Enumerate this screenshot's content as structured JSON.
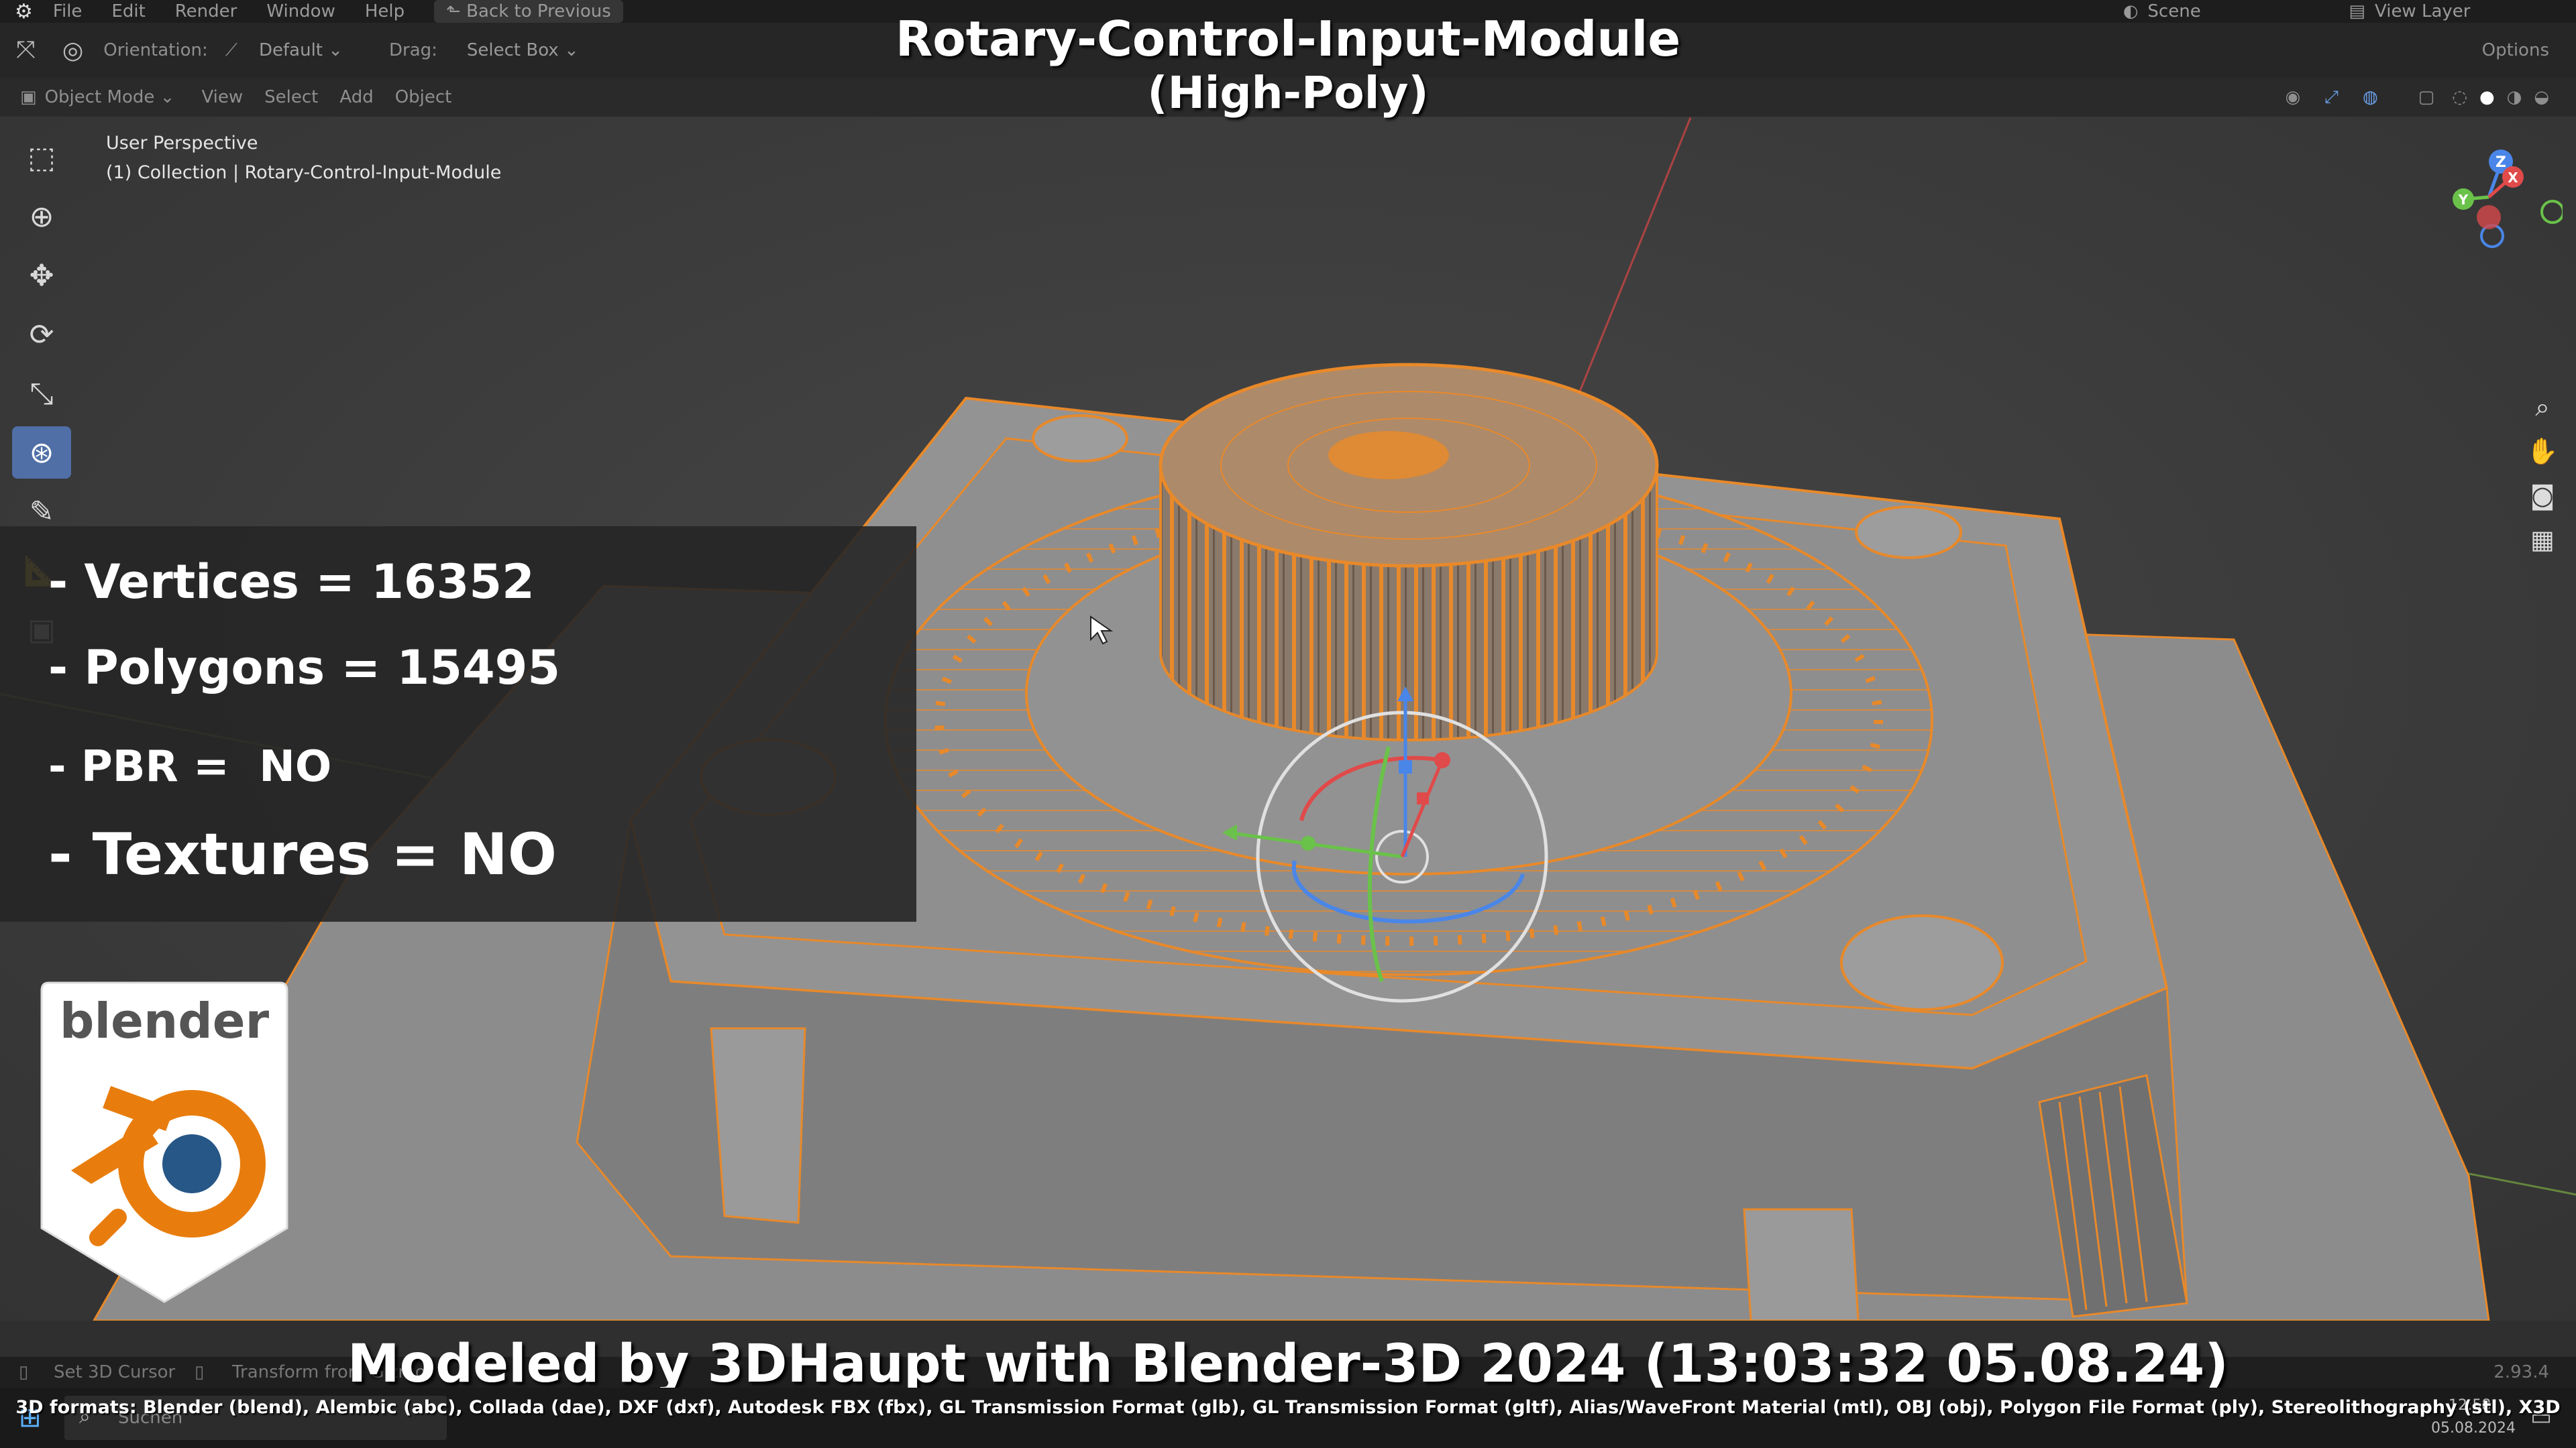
{
  "menubar": {
    "items": [
      "File",
      "Edit",
      "Render",
      "Window",
      "Help"
    ],
    "back_label": "Back to Previous",
    "scene_label": "Scene",
    "view_layer_label": "View Layer"
  },
  "toolbar": {
    "orientation_label": "Orientation:",
    "orientation_value": "Default",
    "drag_label": "Drag:",
    "drag_value": "Select Box",
    "options_label": "Options",
    "mode_value": "Object Mode",
    "menu_items": [
      "View",
      "Select",
      "Add",
      "Object"
    ]
  },
  "viewport": {
    "perspective_label": "User Perspective",
    "collection_label": "(1) Collection | Rotary-Control-Input-Module",
    "accent_color": "#e8892a",
    "axes": {
      "x": "X",
      "y": "Y",
      "z": "Z"
    }
  },
  "overlay": {
    "title_line1": "Rotary-Control-Input-Module",
    "title_line2": "(High-Poly)",
    "stats": [
      "- Vertices = 16352",
      "- Polygons = 15495",
      "- PBR =  NO",
      "- Textures = NO"
    ],
    "logo_text": "blender",
    "credit": "Modeled by 3DHaupt with Blender-3D 2024 (13:03:32  05.08.24)",
    "formats": "3D formats: Blender (blend), Alembic (abc), Collada (dae), DXF (dxf), Autodesk FBX (fbx), GL Transmission Format (glb), GL Transmission Format (gltf), Alias/WaveFront Material (mtl), OBJ (obj), Polygon File Format (ply), Stereolithography (stl), X3D"
  },
  "statusbar": {
    "left_items": [
      "Set 3D Cursor",
      "Transform from Gizmo"
    ],
    "version": "2.93.4"
  },
  "taskbar": {
    "search_placeholder": "Suchen",
    "time": "12:58",
    "date": "05.08.2024"
  }
}
